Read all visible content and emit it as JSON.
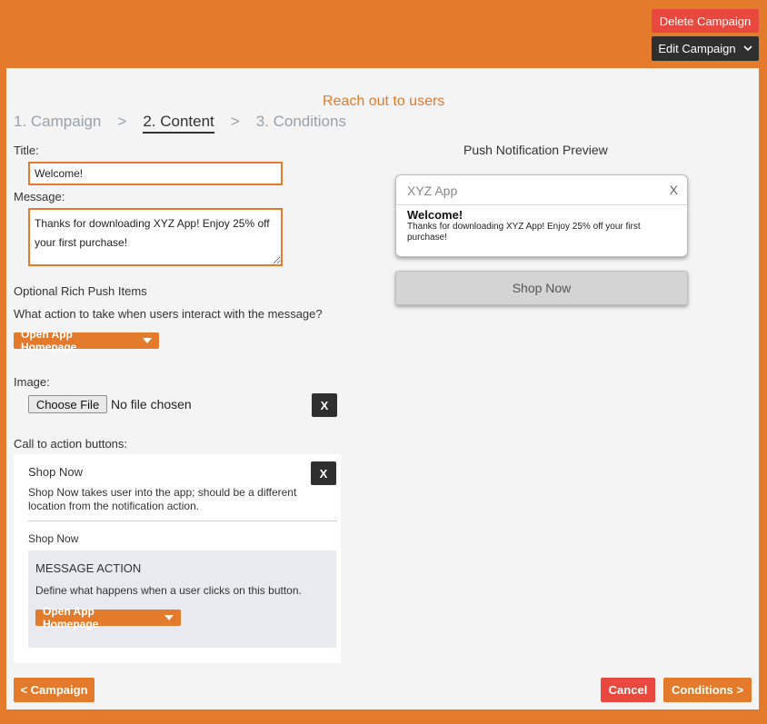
{
  "header": {
    "delete_label": "Delete Campaign",
    "edit_label": "Edit Campaign"
  },
  "wizard": {
    "heading": "Reach out to users",
    "steps": [
      "1. Campaign",
      "2. Content",
      "3. Conditions"
    ],
    "separator": ">",
    "active_step": "2. Content"
  },
  "form": {
    "title_label": "Title:",
    "title_value": "Welcome!",
    "message_label": "Message:",
    "message_value": "Thanks for downloading XYZ App! Enjoy 25% off your first purchase!",
    "rich_label": "Optional Rich Push Items",
    "action_question": "What action to take when users interact with the message?",
    "action_selected": "Open App Homepage",
    "image_label": "Image:",
    "file_button": "Choose File",
    "file_status": "No file chosen",
    "remove_label": "X",
    "cta_label": "Call to action buttons:"
  },
  "cta": {
    "title": "Shop Now",
    "description": "Shop Now takes user into the app; should be a different location from the notification action.",
    "button_name": "Shop Now",
    "message_action_title": "MESSAGE ACTION",
    "message_action_desc": "Define what happens when a user clicks on this button.",
    "action_selected": "Open App Homepage",
    "remove_label": "X"
  },
  "preview": {
    "heading": "Push Notification Preview",
    "app_name": "XYZ App",
    "close": "X",
    "title": "Welcome!",
    "body": "Thanks for downloading XYZ App! Enjoy 25% off your first purchase!",
    "button": "Shop Now"
  },
  "footer": {
    "back_label": "< Campaign",
    "cancel_label": "Cancel",
    "next_label": "Conditions >"
  },
  "colors": {
    "accent": "#e47a2b",
    "danger": "#e8483d",
    "dark": "#2f2f2f",
    "panel": "#f4f4f4"
  }
}
